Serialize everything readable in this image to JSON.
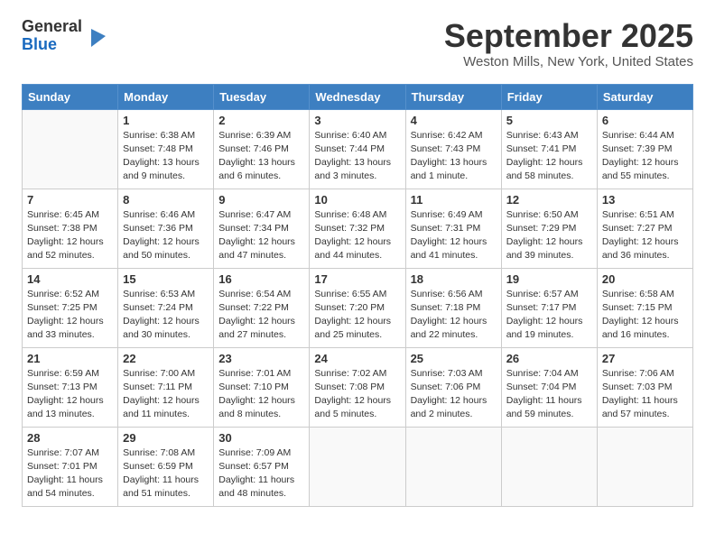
{
  "header": {
    "logo_line1": "General",
    "logo_line2": "Blue",
    "month_title": "September 2025",
    "location": "Weston Mills, New York, United States"
  },
  "days_of_week": [
    "Sunday",
    "Monday",
    "Tuesday",
    "Wednesday",
    "Thursday",
    "Friday",
    "Saturday"
  ],
  "weeks": [
    [
      {
        "day": "",
        "info": ""
      },
      {
        "day": "1",
        "info": "Sunrise: 6:38 AM\nSunset: 7:48 PM\nDaylight: 13 hours\nand 9 minutes."
      },
      {
        "day": "2",
        "info": "Sunrise: 6:39 AM\nSunset: 7:46 PM\nDaylight: 13 hours\nand 6 minutes."
      },
      {
        "day": "3",
        "info": "Sunrise: 6:40 AM\nSunset: 7:44 PM\nDaylight: 13 hours\nand 3 minutes."
      },
      {
        "day": "4",
        "info": "Sunrise: 6:42 AM\nSunset: 7:43 PM\nDaylight: 13 hours\nand 1 minute."
      },
      {
        "day": "5",
        "info": "Sunrise: 6:43 AM\nSunset: 7:41 PM\nDaylight: 12 hours\nand 58 minutes."
      },
      {
        "day": "6",
        "info": "Sunrise: 6:44 AM\nSunset: 7:39 PM\nDaylight: 12 hours\nand 55 minutes."
      }
    ],
    [
      {
        "day": "7",
        "info": "Sunrise: 6:45 AM\nSunset: 7:38 PM\nDaylight: 12 hours\nand 52 minutes."
      },
      {
        "day": "8",
        "info": "Sunrise: 6:46 AM\nSunset: 7:36 PM\nDaylight: 12 hours\nand 50 minutes."
      },
      {
        "day": "9",
        "info": "Sunrise: 6:47 AM\nSunset: 7:34 PM\nDaylight: 12 hours\nand 47 minutes."
      },
      {
        "day": "10",
        "info": "Sunrise: 6:48 AM\nSunset: 7:32 PM\nDaylight: 12 hours\nand 44 minutes."
      },
      {
        "day": "11",
        "info": "Sunrise: 6:49 AM\nSunset: 7:31 PM\nDaylight: 12 hours\nand 41 minutes."
      },
      {
        "day": "12",
        "info": "Sunrise: 6:50 AM\nSunset: 7:29 PM\nDaylight: 12 hours\nand 39 minutes."
      },
      {
        "day": "13",
        "info": "Sunrise: 6:51 AM\nSunset: 7:27 PM\nDaylight: 12 hours\nand 36 minutes."
      }
    ],
    [
      {
        "day": "14",
        "info": "Sunrise: 6:52 AM\nSunset: 7:25 PM\nDaylight: 12 hours\nand 33 minutes."
      },
      {
        "day": "15",
        "info": "Sunrise: 6:53 AM\nSunset: 7:24 PM\nDaylight: 12 hours\nand 30 minutes."
      },
      {
        "day": "16",
        "info": "Sunrise: 6:54 AM\nSunset: 7:22 PM\nDaylight: 12 hours\nand 27 minutes."
      },
      {
        "day": "17",
        "info": "Sunrise: 6:55 AM\nSunset: 7:20 PM\nDaylight: 12 hours\nand 25 minutes."
      },
      {
        "day": "18",
        "info": "Sunrise: 6:56 AM\nSunset: 7:18 PM\nDaylight: 12 hours\nand 22 minutes."
      },
      {
        "day": "19",
        "info": "Sunrise: 6:57 AM\nSunset: 7:17 PM\nDaylight: 12 hours\nand 19 minutes."
      },
      {
        "day": "20",
        "info": "Sunrise: 6:58 AM\nSunset: 7:15 PM\nDaylight: 12 hours\nand 16 minutes."
      }
    ],
    [
      {
        "day": "21",
        "info": "Sunrise: 6:59 AM\nSunset: 7:13 PM\nDaylight: 12 hours\nand 13 minutes."
      },
      {
        "day": "22",
        "info": "Sunrise: 7:00 AM\nSunset: 7:11 PM\nDaylight: 12 hours\nand 11 minutes."
      },
      {
        "day": "23",
        "info": "Sunrise: 7:01 AM\nSunset: 7:10 PM\nDaylight: 12 hours\nand 8 minutes."
      },
      {
        "day": "24",
        "info": "Sunrise: 7:02 AM\nSunset: 7:08 PM\nDaylight: 12 hours\nand 5 minutes."
      },
      {
        "day": "25",
        "info": "Sunrise: 7:03 AM\nSunset: 7:06 PM\nDaylight: 12 hours\nand 2 minutes."
      },
      {
        "day": "26",
        "info": "Sunrise: 7:04 AM\nSunset: 7:04 PM\nDaylight: 11 hours\nand 59 minutes."
      },
      {
        "day": "27",
        "info": "Sunrise: 7:06 AM\nSunset: 7:03 PM\nDaylight: 11 hours\nand 57 minutes."
      }
    ],
    [
      {
        "day": "28",
        "info": "Sunrise: 7:07 AM\nSunset: 7:01 PM\nDaylight: 11 hours\nand 54 minutes."
      },
      {
        "day": "29",
        "info": "Sunrise: 7:08 AM\nSunset: 6:59 PM\nDaylight: 11 hours\nand 51 minutes."
      },
      {
        "day": "30",
        "info": "Sunrise: 7:09 AM\nSunset: 6:57 PM\nDaylight: 11 hours\nand 48 minutes."
      },
      {
        "day": "",
        "info": ""
      },
      {
        "day": "",
        "info": ""
      },
      {
        "day": "",
        "info": ""
      },
      {
        "day": "",
        "info": ""
      }
    ]
  ]
}
